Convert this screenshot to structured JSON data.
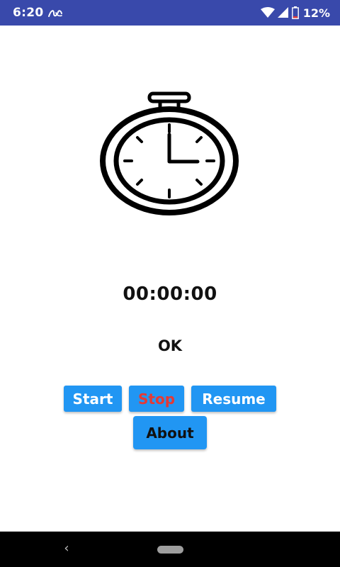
{
  "status_bar": {
    "time": "6:20",
    "battery_percent": "12%",
    "icons": [
      "app-notification-icon",
      "wifi-icon",
      "signal-icon",
      "battery-icon"
    ],
    "background_color": "#3949ab"
  },
  "main": {
    "timer": "00:00:00",
    "status": "OK",
    "icon": "stopwatch-icon"
  },
  "buttons": {
    "start": "Start",
    "stop": "Stop",
    "resume": "Resume",
    "about": "About"
  },
  "nav_bar": {
    "back": "‹",
    "icons": [
      "back-icon",
      "home-pill-icon"
    ]
  },
  "colors": {
    "button_bg": "#2196f3",
    "stop_text": "#e53935",
    "status_bar": "#3949ab"
  }
}
